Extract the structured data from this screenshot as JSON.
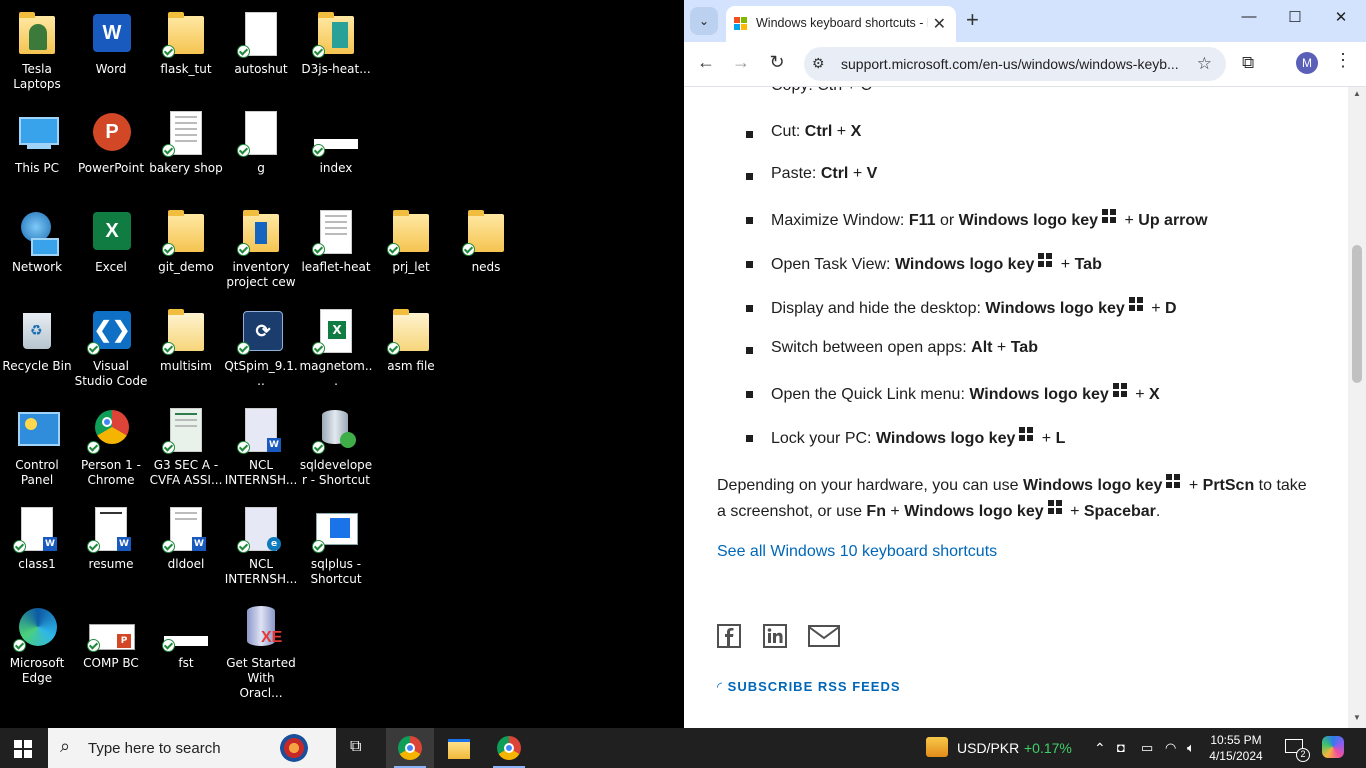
{
  "desktop": {
    "icons": [
      {
        "label": "Tesla Laptops"
      },
      {
        "label": "Word"
      },
      {
        "label": "flask_tut"
      },
      {
        "label": "autoshut"
      },
      {
        "label": "D3js-heat..."
      },
      {
        "label": "This PC"
      },
      {
        "label": "PowerPoint"
      },
      {
        "label": "bakery shop"
      },
      {
        "label": "g"
      },
      {
        "label": "index"
      },
      {
        "label": "Network"
      },
      {
        "label": "Excel"
      },
      {
        "label": "git_demo"
      },
      {
        "label": "inventory project cew"
      },
      {
        "label": "leaflet-heat"
      },
      {
        "label": "prj_let"
      },
      {
        "label": "neds"
      },
      {
        "label": "Recycle Bin"
      },
      {
        "label": "Visual Studio Code"
      },
      {
        "label": "multisim"
      },
      {
        "label": "QtSpim_9.1..."
      },
      {
        "label": "magnetom..."
      },
      {
        "label": "asm file"
      },
      {
        "label": "Control Panel"
      },
      {
        "label": "Person 1 - Chrome"
      },
      {
        "label": "G3 SEC A - CVFA ASSI..."
      },
      {
        "label": "NCL INTERNSH..."
      },
      {
        "label": "sqldeveloper - Shortcut"
      },
      {
        "label": "class1"
      },
      {
        "label": "resume"
      },
      {
        "label": "dldoel"
      },
      {
        "label": "NCL INTERNSH..."
      },
      {
        "label": "sqlplus - Shortcut"
      },
      {
        "label": "Microsoft Edge"
      },
      {
        "label": "COMP BC"
      },
      {
        "label": "fst"
      },
      {
        "label": "Get Started With Oracl..."
      }
    ]
  },
  "browser": {
    "tab_title": "Windows keyboard shortcuts - M",
    "url": "support.microsoft.com/en-us/windows/windows-keyb...",
    "avatar_letter": "M",
    "window_controls": {
      "minimize": "—",
      "maximize": "☐",
      "close": "✕"
    }
  },
  "article": {
    "partial_top": "Copy: Ctrl + C",
    "shortcuts": [
      {
        "label": "Cut:",
        "keys": [
          {
            "t": "Ctrl",
            "b": true
          },
          {
            "t": " + ",
            "b": false
          },
          {
            "t": "X",
            "b": true
          }
        ]
      },
      {
        "label": "Paste:",
        "keys": [
          {
            "t": "Ctrl",
            "b": true
          },
          {
            "t": " + ",
            "b": false
          },
          {
            "t": "V",
            "b": true
          }
        ]
      },
      {
        "label": "Maximize Window:",
        "keys": [
          {
            "t": "F11",
            "b": true
          },
          {
            "t": " or ",
            "b": false
          },
          {
            "t": "Windows logo key",
            "b": true
          },
          {
            "logo": true
          },
          {
            "t": " + ",
            "b": false
          },
          {
            "t": "Up arrow",
            "b": true
          }
        ]
      },
      {
        "label": "Open Task View:",
        "keys": [
          {
            "t": "Windows logo key",
            "b": true
          },
          {
            "logo": true
          },
          {
            "t": " + ",
            "b": false
          },
          {
            "t": "Tab",
            "b": true
          }
        ]
      },
      {
        "label": "Display and hide the desktop:",
        "keys": [
          {
            "t": "Windows logo key",
            "b": true
          },
          {
            "logo": true
          },
          {
            "t": " + ",
            "b": false
          },
          {
            "t": "D",
            "b": true
          }
        ]
      },
      {
        "label": "Switch between open apps:",
        "keys": [
          {
            "t": "Alt",
            "b": true
          },
          {
            "t": " + ",
            "b": false
          },
          {
            "t": "Tab",
            "b": true
          }
        ]
      },
      {
        "label": "Open the Quick Link menu:",
        "keys": [
          {
            "t": "Windows logo key",
            "b": true
          },
          {
            "logo": true
          },
          {
            "t": " + ",
            "b": false
          },
          {
            "t": "X",
            "b": true
          }
        ]
      },
      {
        "label": "Lock your PC:",
        "keys": [
          {
            "t": "Windows logo key",
            "b": true
          },
          {
            "logo": true
          },
          {
            "t": " + ",
            "b": false
          },
          {
            "t": "L",
            "b": true
          }
        ]
      }
    ],
    "para_parts": [
      {
        "t": "Depending on your hardware, you can use ",
        "b": false
      },
      {
        "t": "Windows logo key",
        "b": true
      },
      {
        "logo": true
      },
      {
        "t": " + ",
        "b": false
      },
      {
        "t": "PrtScn",
        "b": true
      },
      {
        "t": " to take a screenshot, or use ",
        "b": false
      },
      {
        "t": "Fn",
        "b": true
      },
      {
        "t": " + ",
        "b": false
      },
      {
        "t": "Windows logo key",
        "b": true
      },
      {
        "logo": true
      },
      {
        "t": " + ",
        "b": false
      },
      {
        "t": "Spacebar",
        "b": true
      },
      {
        "t": ".",
        "b": false
      }
    ],
    "see_all_link": "See all Windows 10 keyboard shortcuts",
    "rss_label": "SUBSCRIBE RSS FEEDS"
  },
  "taskbar": {
    "search_placeholder": "Type here to search",
    "currency_label": "USD/PKR",
    "currency_change": "+0.17%",
    "currency_change_color": "#3fd06a",
    "time": "10:55 PM",
    "date": "4/15/2024",
    "notification_count": "2"
  }
}
